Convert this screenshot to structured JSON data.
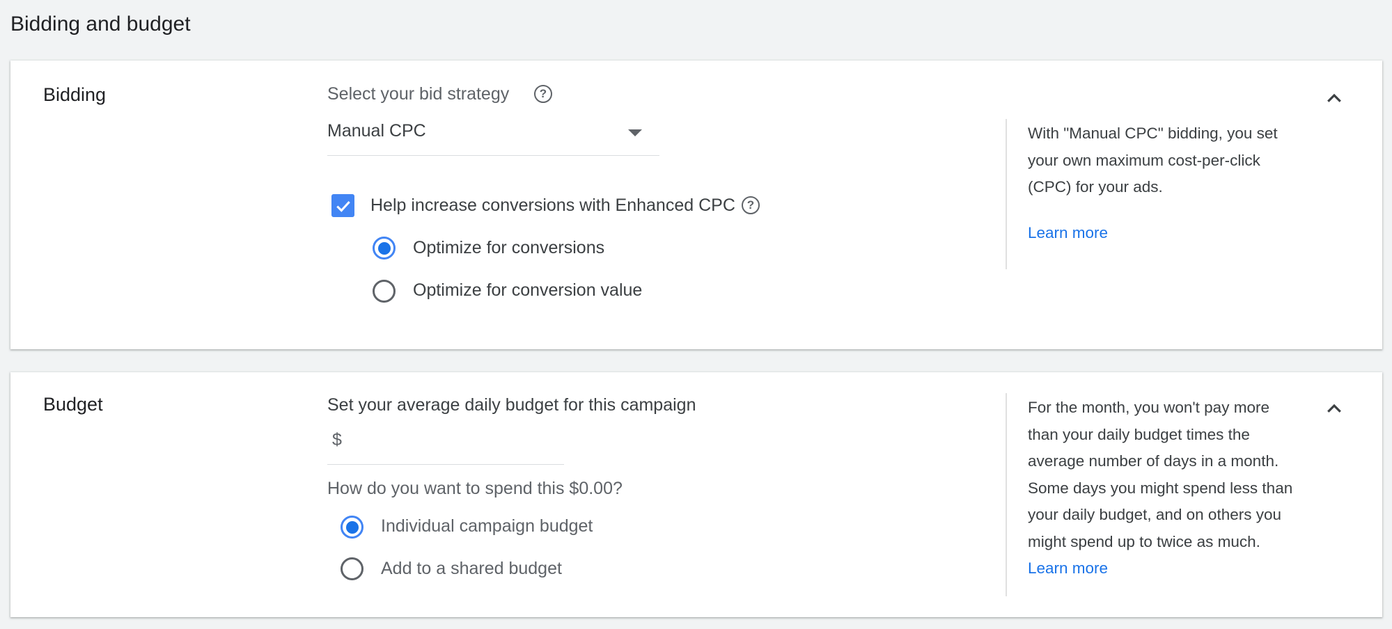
{
  "page": {
    "title": "Bidding and budget"
  },
  "bidding": {
    "section_title": "Bidding",
    "strategy_label": "Select your bid strategy",
    "strategy_value": "Manual CPC",
    "enhanced_cpc": {
      "label": "Help increase conversions with Enhanced CPC",
      "checked": true
    },
    "options": [
      {
        "label": "Optimize for conversions",
        "selected": true
      },
      {
        "label": "Optimize for conversion value",
        "selected": false
      }
    ],
    "side_text": "With \"Manual CPC\" bidding, you set your own maximum cost-per-click (CPC) for your ads.",
    "learn_more": "Learn more"
  },
  "budget": {
    "section_title": "Budget",
    "daily_label": "Set your average daily budget for this campaign",
    "currency_symbol": "$",
    "amount_value": "",
    "spend_question": "How do you want to spend this $0.00?",
    "options": [
      {
        "label": "Individual campaign budget",
        "selected": true
      },
      {
        "label": "Add to a shared budget",
        "selected": false
      }
    ],
    "side_text": "For the month, you won't pay more than your daily budget times the average number of days in a month. Some days you might spend less than your daily budget, and on others you might spend up to twice as much.",
    "learn_more": "Learn more"
  },
  "colors": {
    "accent": "#1a73e8",
    "checkbox": "#4285f4",
    "background": "#f1f3f4"
  }
}
